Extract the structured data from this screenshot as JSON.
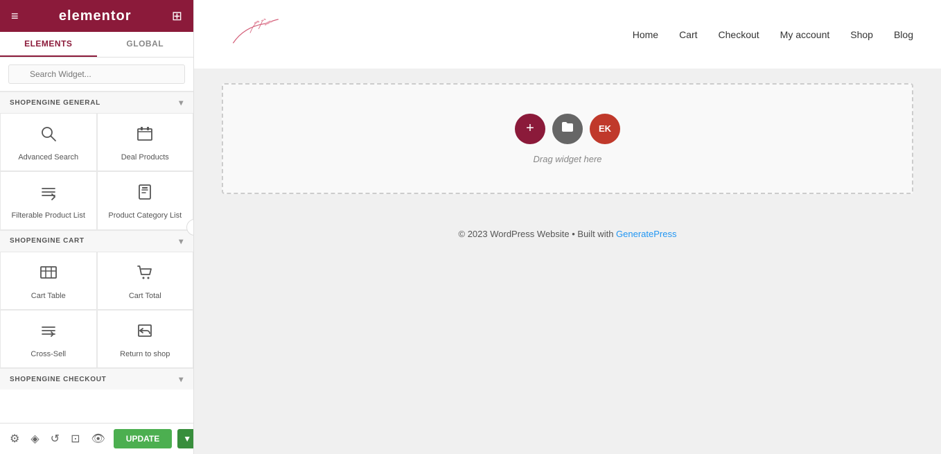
{
  "topbar": {
    "logo": "elementor",
    "hamburger_icon": "≡",
    "grid_icon": "⊞"
  },
  "panel_tabs": [
    {
      "label": "ELEMENTS",
      "active": true
    },
    {
      "label": "GLOBAL",
      "active": false
    }
  ],
  "search": {
    "placeholder": "Search Widget..."
  },
  "sections": [
    {
      "id": "shopengine-general",
      "label": "SHOPENGINE GENERAL",
      "collapsed": false,
      "widgets": [
        {
          "id": "advanced-search",
          "label": "Advanced Search",
          "icon": "🔍"
        },
        {
          "id": "deal-products",
          "label": "Deal Products",
          "icon": "🗃"
        },
        {
          "id": "filterable-product-list",
          "label": "Filterable Product List",
          "icon": "↓≡"
        },
        {
          "id": "product-category-list",
          "label": "Product Category List",
          "icon": "🔒"
        }
      ]
    },
    {
      "id": "shopengine-cart",
      "label": "SHOPENGINE CART",
      "collapsed": false,
      "widgets": [
        {
          "id": "cart-table",
          "label": "Cart Table",
          "icon": "⊞"
        },
        {
          "id": "cart-total",
          "label": "Cart Total",
          "icon": "🛒"
        },
        {
          "id": "cross-sell",
          "label": "Cross-Sell",
          "icon": "↓≡"
        },
        {
          "id": "return-to-shop",
          "label": "Return to shop",
          "icon": "↩"
        }
      ]
    },
    {
      "id": "shopengine-checkout",
      "label": "SHOPENGINE CHECKOUT",
      "collapsed": false,
      "widgets": []
    }
  ],
  "navbar": {
    "links": [
      "Home",
      "Cart",
      "Checkout",
      "My account",
      "Shop",
      "Blog"
    ]
  },
  "canvas": {
    "drag_text": "Drag widget here",
    "add_btn_label": "+",
    "folder_btn_label": "□",
    "ek_btn_label": "EK"
  },
  "footer": {
    "text": "© 2023 WordPress Website • Built with ",
    "link_text": "GeneratePress",
    "link_url": "#"
  },
  "bottom_toolbar": {
    "icons": [
      "⚙",
      "◈",
      "↺",
      "⊡",
      "👁"
    ],
    "update_label": "UPDATE",
    "arrow_label": "▼"
  }
}
